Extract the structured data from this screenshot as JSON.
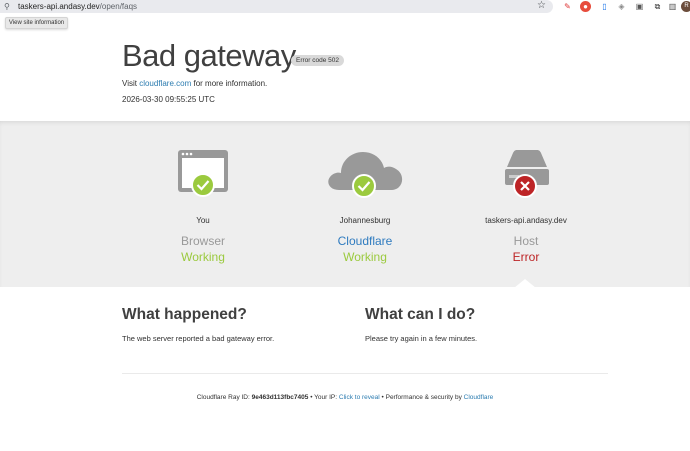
{
  "browser": {
    "url_host": "taskers-api.andasy.dev",
    "url_path": "/open/faqs",
    "tooltip": "View site information",
    "profile_initial": "R"
  },
  "header": {
    "title": "Bad gateway",
    "badge": "Error code 502",
    "visit_prefix": "Visit",
    "visit_link": "cloudflare.com",
    "visit_suffix": "for more information.",
    "timestamp": "2026-03-30 09:55:25 UTC"
  },
  "status": {
    "nodes": [
      {
        "name": "You",
        "kind": "Browser",
        "state": "Working",
        "kind_color": "#999999",
        "state_color": "#9bca3e",
        "icon": "browser-window-icon"
      },
      {
        "name": "Johannesburg",
        "kind": "Cloudflare",
        "state": "Working",
        "kind_color": "#2f7bbf",
        "state_color": "#9bca3e",
        "icon": "cloud-icon"
      },
      {
        "name": "taskers-api.andasy.dev",
        "kind": "Host",
        "state": "Error",
        "kind_color": "#999999",
        "state_color": "#bd2426",
        "icon": "server-icon"
      }
    ]
  },
  "info": {
    "what_happened_title": "What happened?",
    "what_happened_text": "The web server reported a bad gateway error.",
    "what_can_i_do_title": "What can I do?",
    "what_can_i_do_text": "Please try again in a few minutes."
  },
  "footer": {
    "ray_label": "Cloudflare Ray ID:",
    "ray_id": "9e463d113fbc7405",
    "sep1": "•",
    "ip_label": "Your IP:",
    "ip_link": "Click to reveal",
    "sep2": "•",
    "perf_label": "Performance & security by",
    "perf_link": "Cloudflare"
  },
  "colors": {
    "ok": "#9bca3e",
    "error": "#bd2426",
    "link": "#2c7cb0",
    "icon_gray": "#999999"
  }
}
